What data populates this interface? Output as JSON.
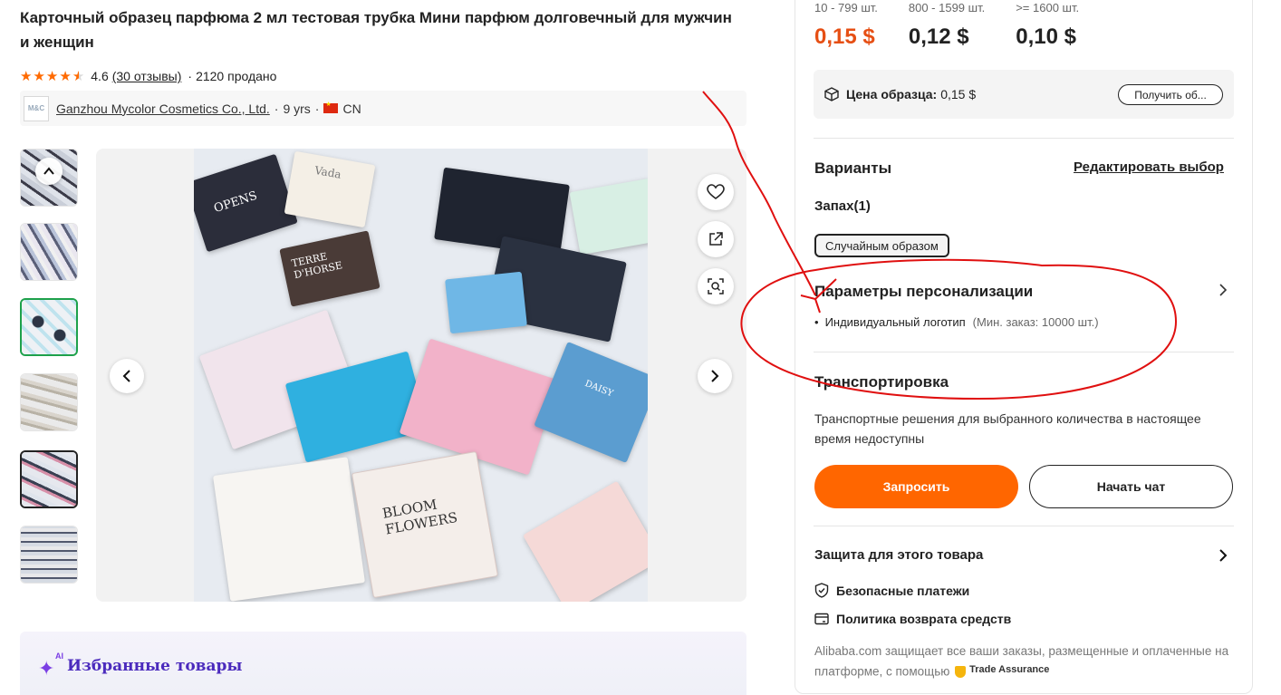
{
  "product": {
    "title": "Карточный образец парфюма 2 мл тестовая трубка Мини парфюм долговечный для мужчин и женщин",
    "rating": "4.6",
    "reviews": "(30 отзывы)",
    "sold": "2120 продано"
  },
  "supplier": {
    "logo_text": "M&C",
    "name": "Ganzhou Mycolor Cosmetics Co., Ltd.",
    "years": "9 yrs",
    "country": "CN"
  },
  "gallery": {
    "box_labels": [
      "OPENS",
      "Vada",
      "TERRE D'HORSE",
      "BLOOM FLOWERS",
      "DAISY"
    ]
  },
  "featured": {
    "ai_badge": "AI",
    "label": "Избранные товары"
  },
  "pricing": {
    "tiers": [
      {
        "qty": "10 - 799 шт.",
        "price": "0,15 $"
      },
      {
        "qty": "800 - 1599 шт.",
        "price": "0,12 $"
      },
      {
        "qty": ">= 1600 шт.",
        "price": "0,10 $"
      }
    ],
    "active_color": "#e64f14"
  },
  "sample": {
    "label": "Цена образца:",
    "price": "0,15 $",
    "button": "Получить об..."
  },
  "variants": {
    "heading": "Варианты",
    "edit_link": "Редактировать выбор",
    "scent_label": "Запах(1)",
    "selected_option": "Случайным образом"
  },
  "customization": {
    "heading": "Параметры персонализации",
    "item": "Индивидуальный логотип",
    "moq": "(Мин. заказ: 10000 шт.)"
  },
  "shipping": {
    "heading": "Транспортировка",
    "text": "Транспортные решения для выбранного количества в настоящее время недоступны"
  },
  "actions": {
    "request": "Запросить",
    "chat": "Начать чат",
    "accent": "#ff6600"
  },
  "protection": {
    "heading": "Защита для этого товара",
    "payments": "Безопасные платежи",
    "returns": "Политика возврата средств",
    "note": "Alibaba.com защищает все ваши заказы, размещенные и оплаченные на платформе, с помощью",
    "badge": "Trade Assurance"
  }
}
